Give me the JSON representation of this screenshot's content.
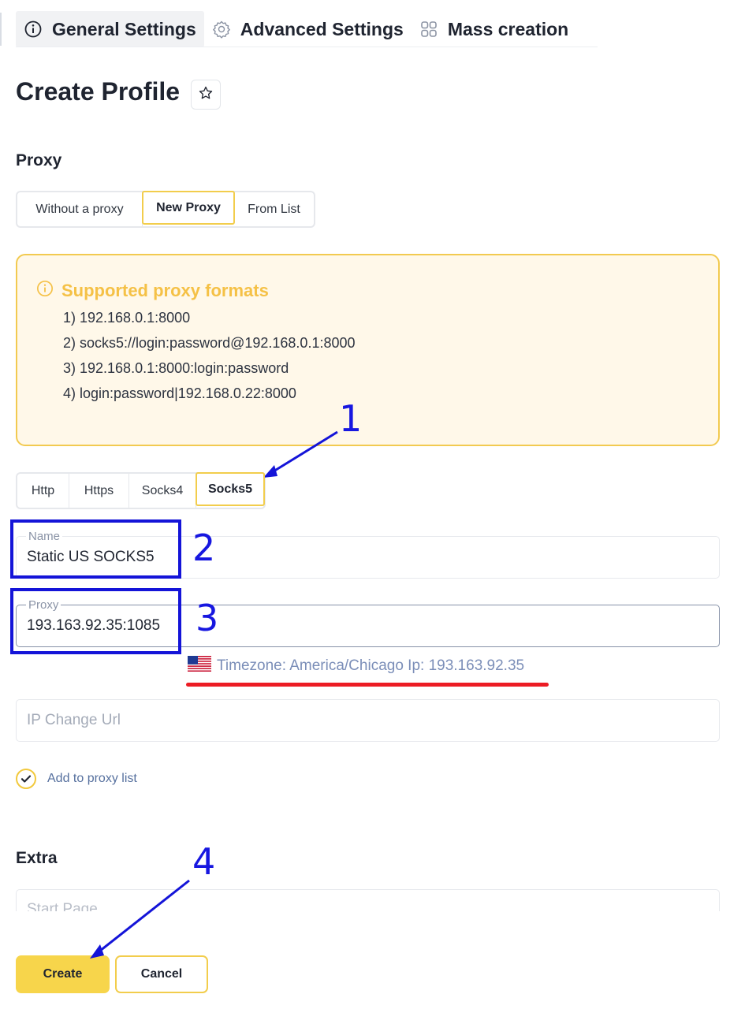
{
  "tabs": {
    "general": "General Settings",
    "advanced": "Advanced Settings",
    "mass": "Mass creation"
  },
  "page": {
    "title": "Create Profile"
  },
  "proxy_section": {
    "title": "Proxy",
    "modes": [
      "Without a proxy",
      "New Proxy",
      "From List"
    ],
    "active_mode": "New Proxy"
  },
  "info": {
    "title": "Supported proxy formats",
    "formats": [
      "1) 192.168.0.1:8000",
      "2) socks5://login:password@192.168.0.1:8000",
      "3) 192.168.0.1:8000:login:password",
      "4) login:password|192.168.0.22:8000"
    ]
  },
  "proxy_types": {
    "items": [
      "Http",
      "Https",
      "Socks4",
      "Socks5"
    ],
    "active": "Socks5"
  },
  "fields": {
    "name_label": "Name",
    "name_value": "Static US SOCKS5",
    "proxy_label": "Proxy",
    "proxy_value": "193.163.92.35:1085",
    "ip_change_placeholder": "IP Change Url",
    "start_page_placeholder": "Start Page"
  },
  "timezone": {
    "text": "Timezone: America/Chicago Ip: 193.163.92.35",
    "flag": "us-flag-icon"
  },
  "add_to_list": {
    "label": "Add to proxy list",
    "checked": true
  },
  "extra_section": {
    "title": "Extra"
  },
  "buttons": {
    "create": "Create",
    "cancel": "Cancel"
  },
  "annotations": [
    "1",
    "2",
    "3",
    "4"
  ],
  "colors": {
    "accent": "#F2CD4C",
    "info_bg": "#FFF8E9",
    "info_title": "#F5C146",
    "annotation_blue": "#1717E0",
    "annotation_red": "#EC1C24",
    "timezone_text": "#7B8EB8"
  }
}
